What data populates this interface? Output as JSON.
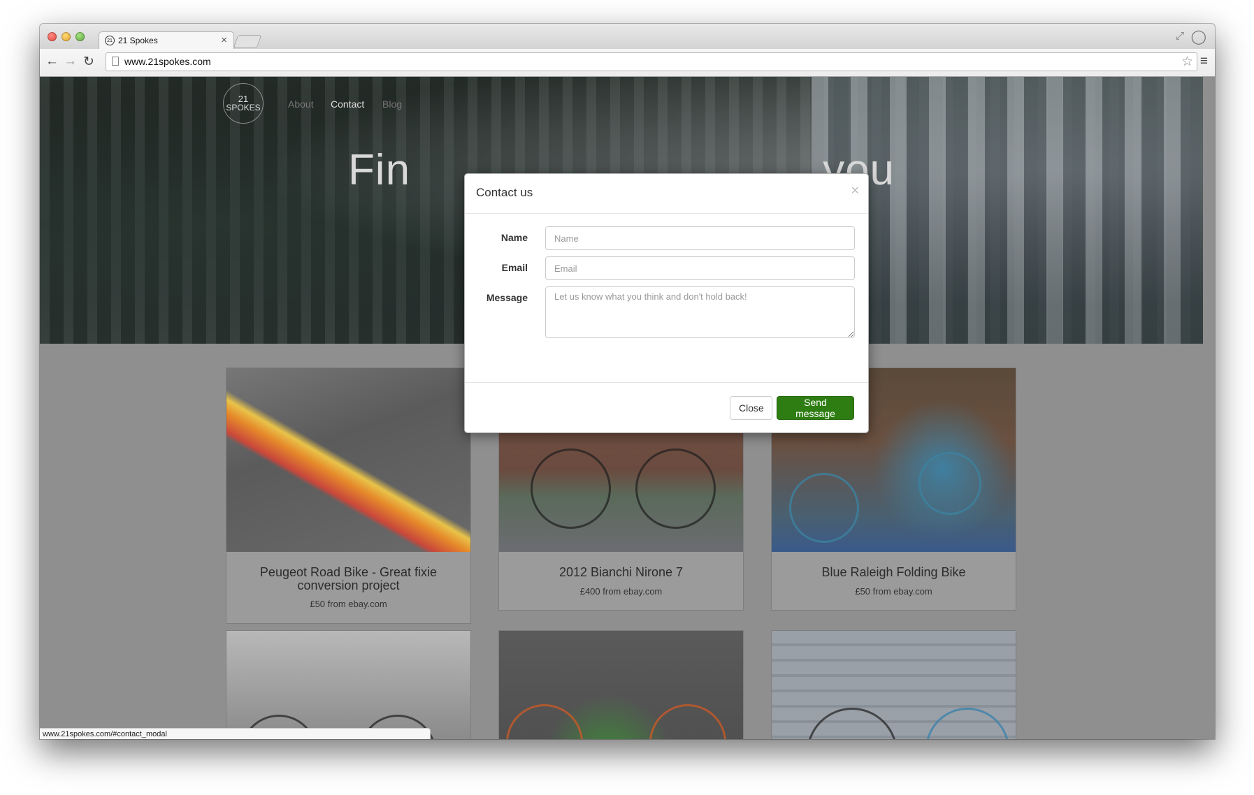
{
  "browser": {
    "tab_title": "21 Spokes",
    "tab_favicon_text": "21",
    "tab_close": "×",
    "url": "www.21spokes.com",
    "status_url": "www.21spokes.com/#contact_modal",
    "back_icon": "arrow-left-icon",
    "forward_icon": "arrow-right-icon",
    "reload_icon": "reload-icon",
    "star_icon": "star-icon",
    "menu_icon": "hamburger-menu-icon"
  },
  "site": {
    "logo_top": "21",
    "logo_bottom": "SPOKES",
    "nav": [
      "About",
      "Contact",
      "Blog"
    ],
    "active_nav": "Contact",
    "hero_heading_left": "Fin",
    "hero_heading_right": "you"
  },
  "listings": [
    {
      "title": "Peugeot Road Bike - Great fixie conversion project",
      "price": "£50 from ebay.com"
    },
    {
      "title": "2012 Bianchi Nirone 7",
      "price": "£400 from ebay.com"
    },
    {
      "title": "Blue Raleigh Folding Bike",
      "price": "£50 from ebay.com"
    }
  ],
  "modal": {
    "title": "Contact us",
    "close_symbol": "×",
    "fields": {
      "name_label": "Name",
      "name_placeholder": "Name",
      "email_label": "Email",
      "email_placeholder": "Email",
      "message_label": "Message",
      "message_placeholder": "Let us know what you think and don't hold back!"
    },
    "close_button": "Close",
    "send_button": "Send message",
    "send_color": "#2e7d13"
  }
}
